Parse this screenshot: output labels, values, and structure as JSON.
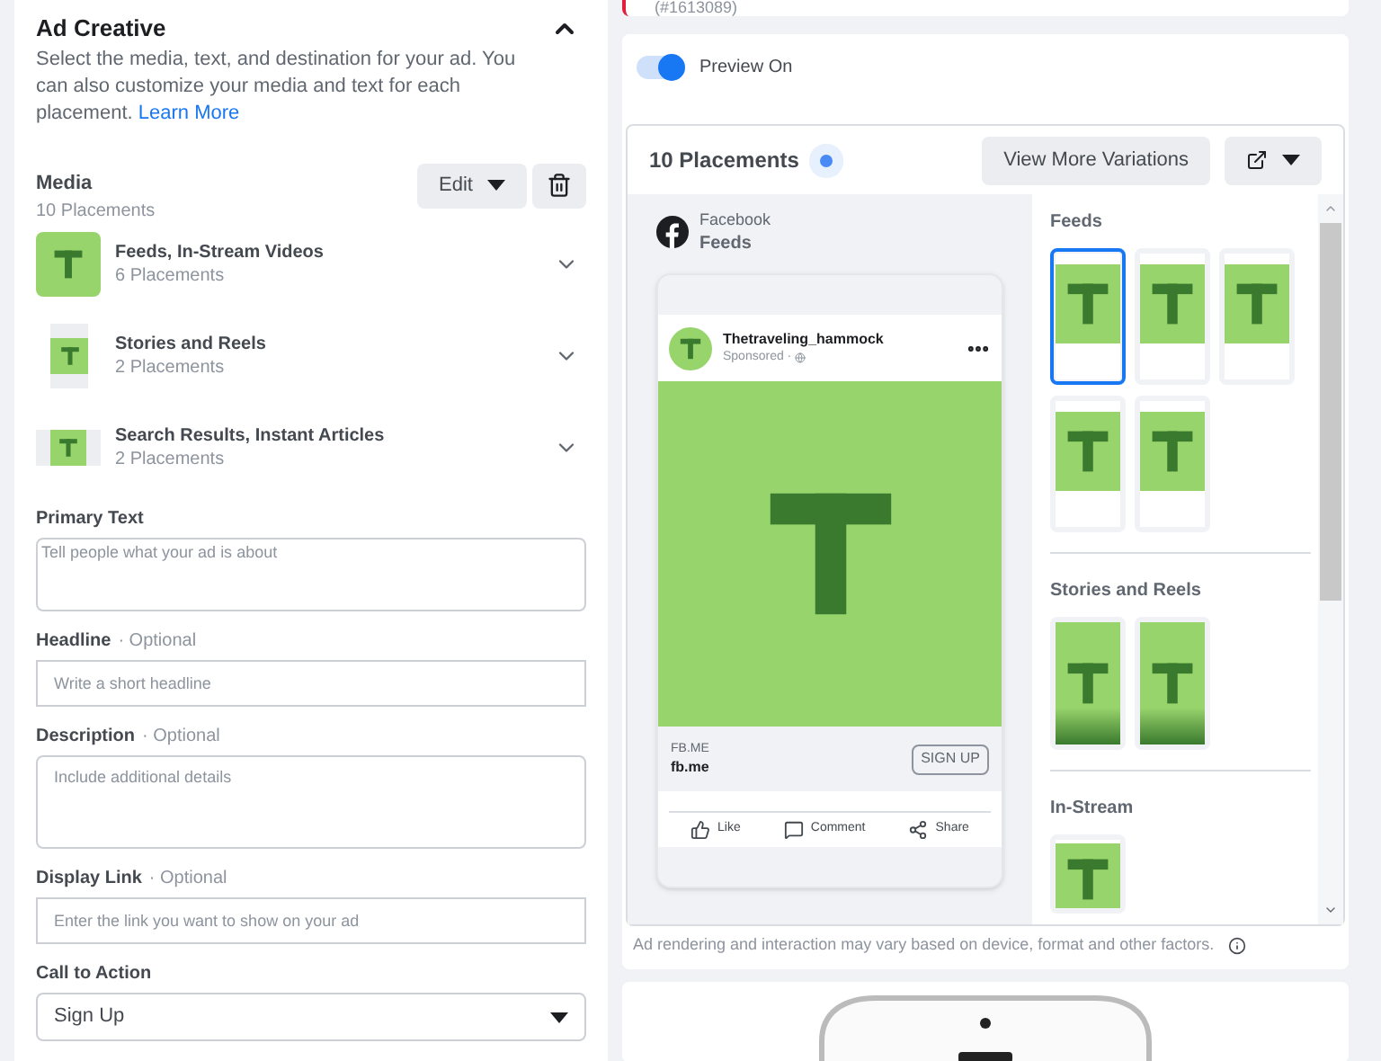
{
  "error_card": {
    "text": "(#1613089)"
  },
  "ad_creative": {
    "title": "Ad Creative",
    "expanded": true,
    "description": "Select the media, text, and destination for your ad. You can also customize your media and text for each placement.",
    "learn_more": "Learn More",
    "media": {
      "label": "Media",
      "count": "10 Placements",
      "edit_button": "Edit",
      "groups": [
        {
          "kind": "square",
          "title": "Feeds, In-Stream Videos",
          "count": "6 Placements"
        },
        {
          "kind": "vertical",
          "title": "Stories and Reels",
          "count": "2 Placements"
        },
        {
          "kind": "horizontal",
          "title": "Search Results, Instant Articles",
          "count": "2 Placements"
        }
      ]
    },
    "fields": [
      {
        "kind": "textarea",
        "label": "Primary Text",
        "placeholder": "Tell people what your ad is about"
      },
      {
        "kind": "input",
        "label": "Headline",
        "optional": "· Optional",
        "placeholder": "Write a short headline"
      },
      {
        "kind": "textarea",
        "label": "Description",
        "optional": "· Optional",
        "placeholder": "Include additional details"
      },
      {
        "kind": "input",
        "label": "Display Link",
        "optional": "· Optional",
        "placeholder": "Enter the link you want to show on your ad"
      },
      {
        "kind": "select",
        "label": "Call to Action",
        "value": "Sign Up"
      }
    ]
  },
  "preview": {
    "toggle": {
      "label": "Preview On",
      "on": true
    },
    "placements_title": "10 Placements",
    "view_more": "View More Variations",
    "platform": "Facebook",
    "placement": "Feeds",
    "post": {
      "account": "Thetraveling_hammock",
      "sponsored": "Sponsored ·",
      "link_caption": "FB.ME",
      "link_domain": "fb.me",
      "cta": "SIGN UP",
      "actions": [
        {
          "kind": "like",
          "label": "Like"
        },
        {
          "kind": "comment",
          "label": "Comment"
        },
        {
          "kind": "share",
          "label": "Share"
        }
      ]
    },
    "sections": [
      {
        "title": "Feeds",
        "thumbs": [
          {
            "kind": "feed",
            "selected": true
          },
          {
            "kind": "feed",
            "selected": false
          },
          {
            "kind": "feed",
            "selected": false
          },
          {
            "kind": "feed",
            "selected": false
          },
          {
            "kind": "feed",
            "selected": false
          }
        ]
      },
      {
        "title": "Stories and Reels",
        "thumbs": [
          {
            "kind": "story",
            "selected": false
          },
          {
            "kind": "story",
            "selected": false
          }
        ]
      },
      {
        "title": "In-Stream",
        "thumbs": [
          {
            "kind": "instream",
            "selected": false
          }
        ]
      }
    ],
    "disclaimer": "Ad rendering and interaction may vary based on device, format and other factors."
  }
}
